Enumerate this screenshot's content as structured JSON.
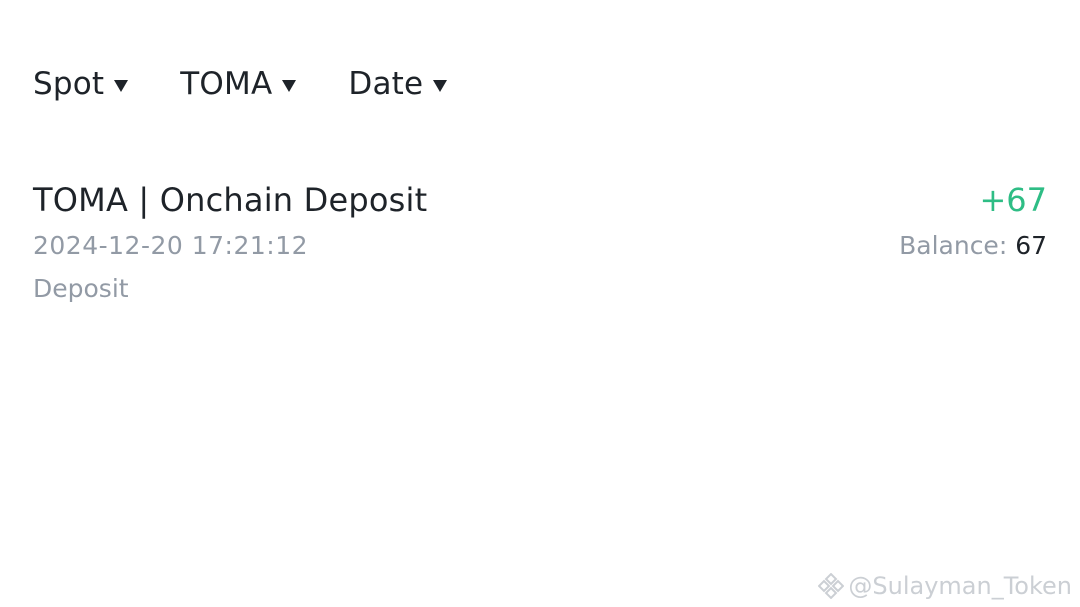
{
  "filters": {
    "account": "Spot",
    "coin": "TOMA",
    "date": "Date"
  },
  "transaction": {
    "title": "TOMA | Onchain Deposit",
    "amount": "+67",
    "timestamp": "2024-12-20 17:21:12",
    "balance_label": "Balance: ",
    "balance_value": "67",
    "type": "Deposit"
  },
  "watermark": {
    "text": "@Sulayman_Token",
    "icon": "binance-logo-icon"
  },
  "colors": {
    "positive": "#2ebd85",
    "primary_text": "#1e2329",
    "secondary_text": "#929aa5"
  }
}
